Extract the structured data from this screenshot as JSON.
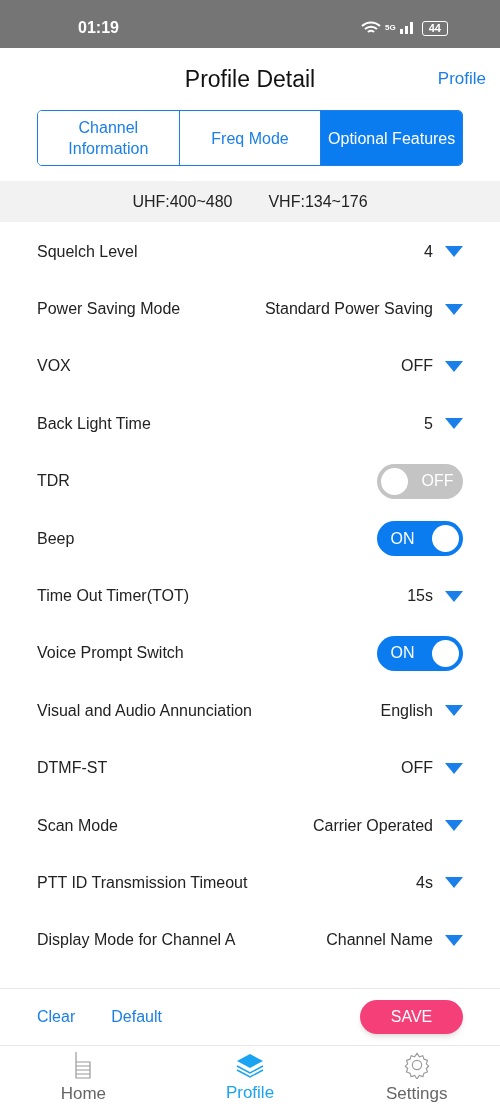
{
  "status_bar": {
    "time": "01:19",
    "network": "5G",
    "battery": "44"
  },
  "header": {
    "title": "Profile Detail",
    "link": "Profile"
  },
  "tabs": [
    {
      "label": "Channel Information",
      "selected": false
    },
    {
      "label": "Freq Mode",
      "selected": false
    },
    {
      "label": "Optional Features",
      "selected": true
    }
  ],
  "bands": [
    "UHF:400~480",
    "VHF:134~176"
  ],
  "settings": [
    {
      "kind": "dropdown",
      "label": "Squelch Level",
      "value": "4"
    },
    {
      "kind": "dropdown",
      "label": "Power Saving Mode",
      "value": "Standard Power Saving"
    },
    {
      "kind": "dropdown",
      "label": "VOX",
      "value": "OFF"
    },
    {
      "kind": "dropdown",
      "label": "Back Light Time",
      "value": "5"
    },
    {
      "kind": "toggle",
      "label": "TDR",
      "value": "OFF",
      "on": false
    },
    {
      "kind": "toggle",
      "label": "Beep",
      "value": "ON",
      "on": true
    },
    {
      "kind": "dropdown",
      "label": "Time Out Timer(TOT)",
      "value": "15s"
    },
    {
      "kind": "toggle",
      "label": "Voice Prompt Switch",
      "value": "ON",
      "on": true
    },
    {
      "kind": "dropdown",
      "label": "Visual and Audio Annunciation",
      "value": "English"
    },
    {
      "kind": "dropdown",
      "label": "DTMF-ST",
      "value": "OFF"
    },
    {
      "kind": "dropdown",
      "label": "Scan Mode",
      "value": "Carrier Operated"
    },
    {
      "kind": "dropdown",
      "label": "PTT ID Transmission Timeout",
      "value": "4s"
    },
    {
      "kind": "dropdown",
      "label": "Display Mode for Channel A",
      "value": "Channel Name"
    }
  ],
  "actions": {
    "clear": "Clear",
    "default": "Default",
    "save": "SAVE"
  },
  "nav": [
    {
      "kind": "home",
      "label": "Home",
      "selected": false
    },
    {
      "kind": "profile",
      "label": "Profile",
      "selected": true
    },
    {
      "kind": "settings",
      "label": "Settings",
      "selected": false
    }
  ]
}
